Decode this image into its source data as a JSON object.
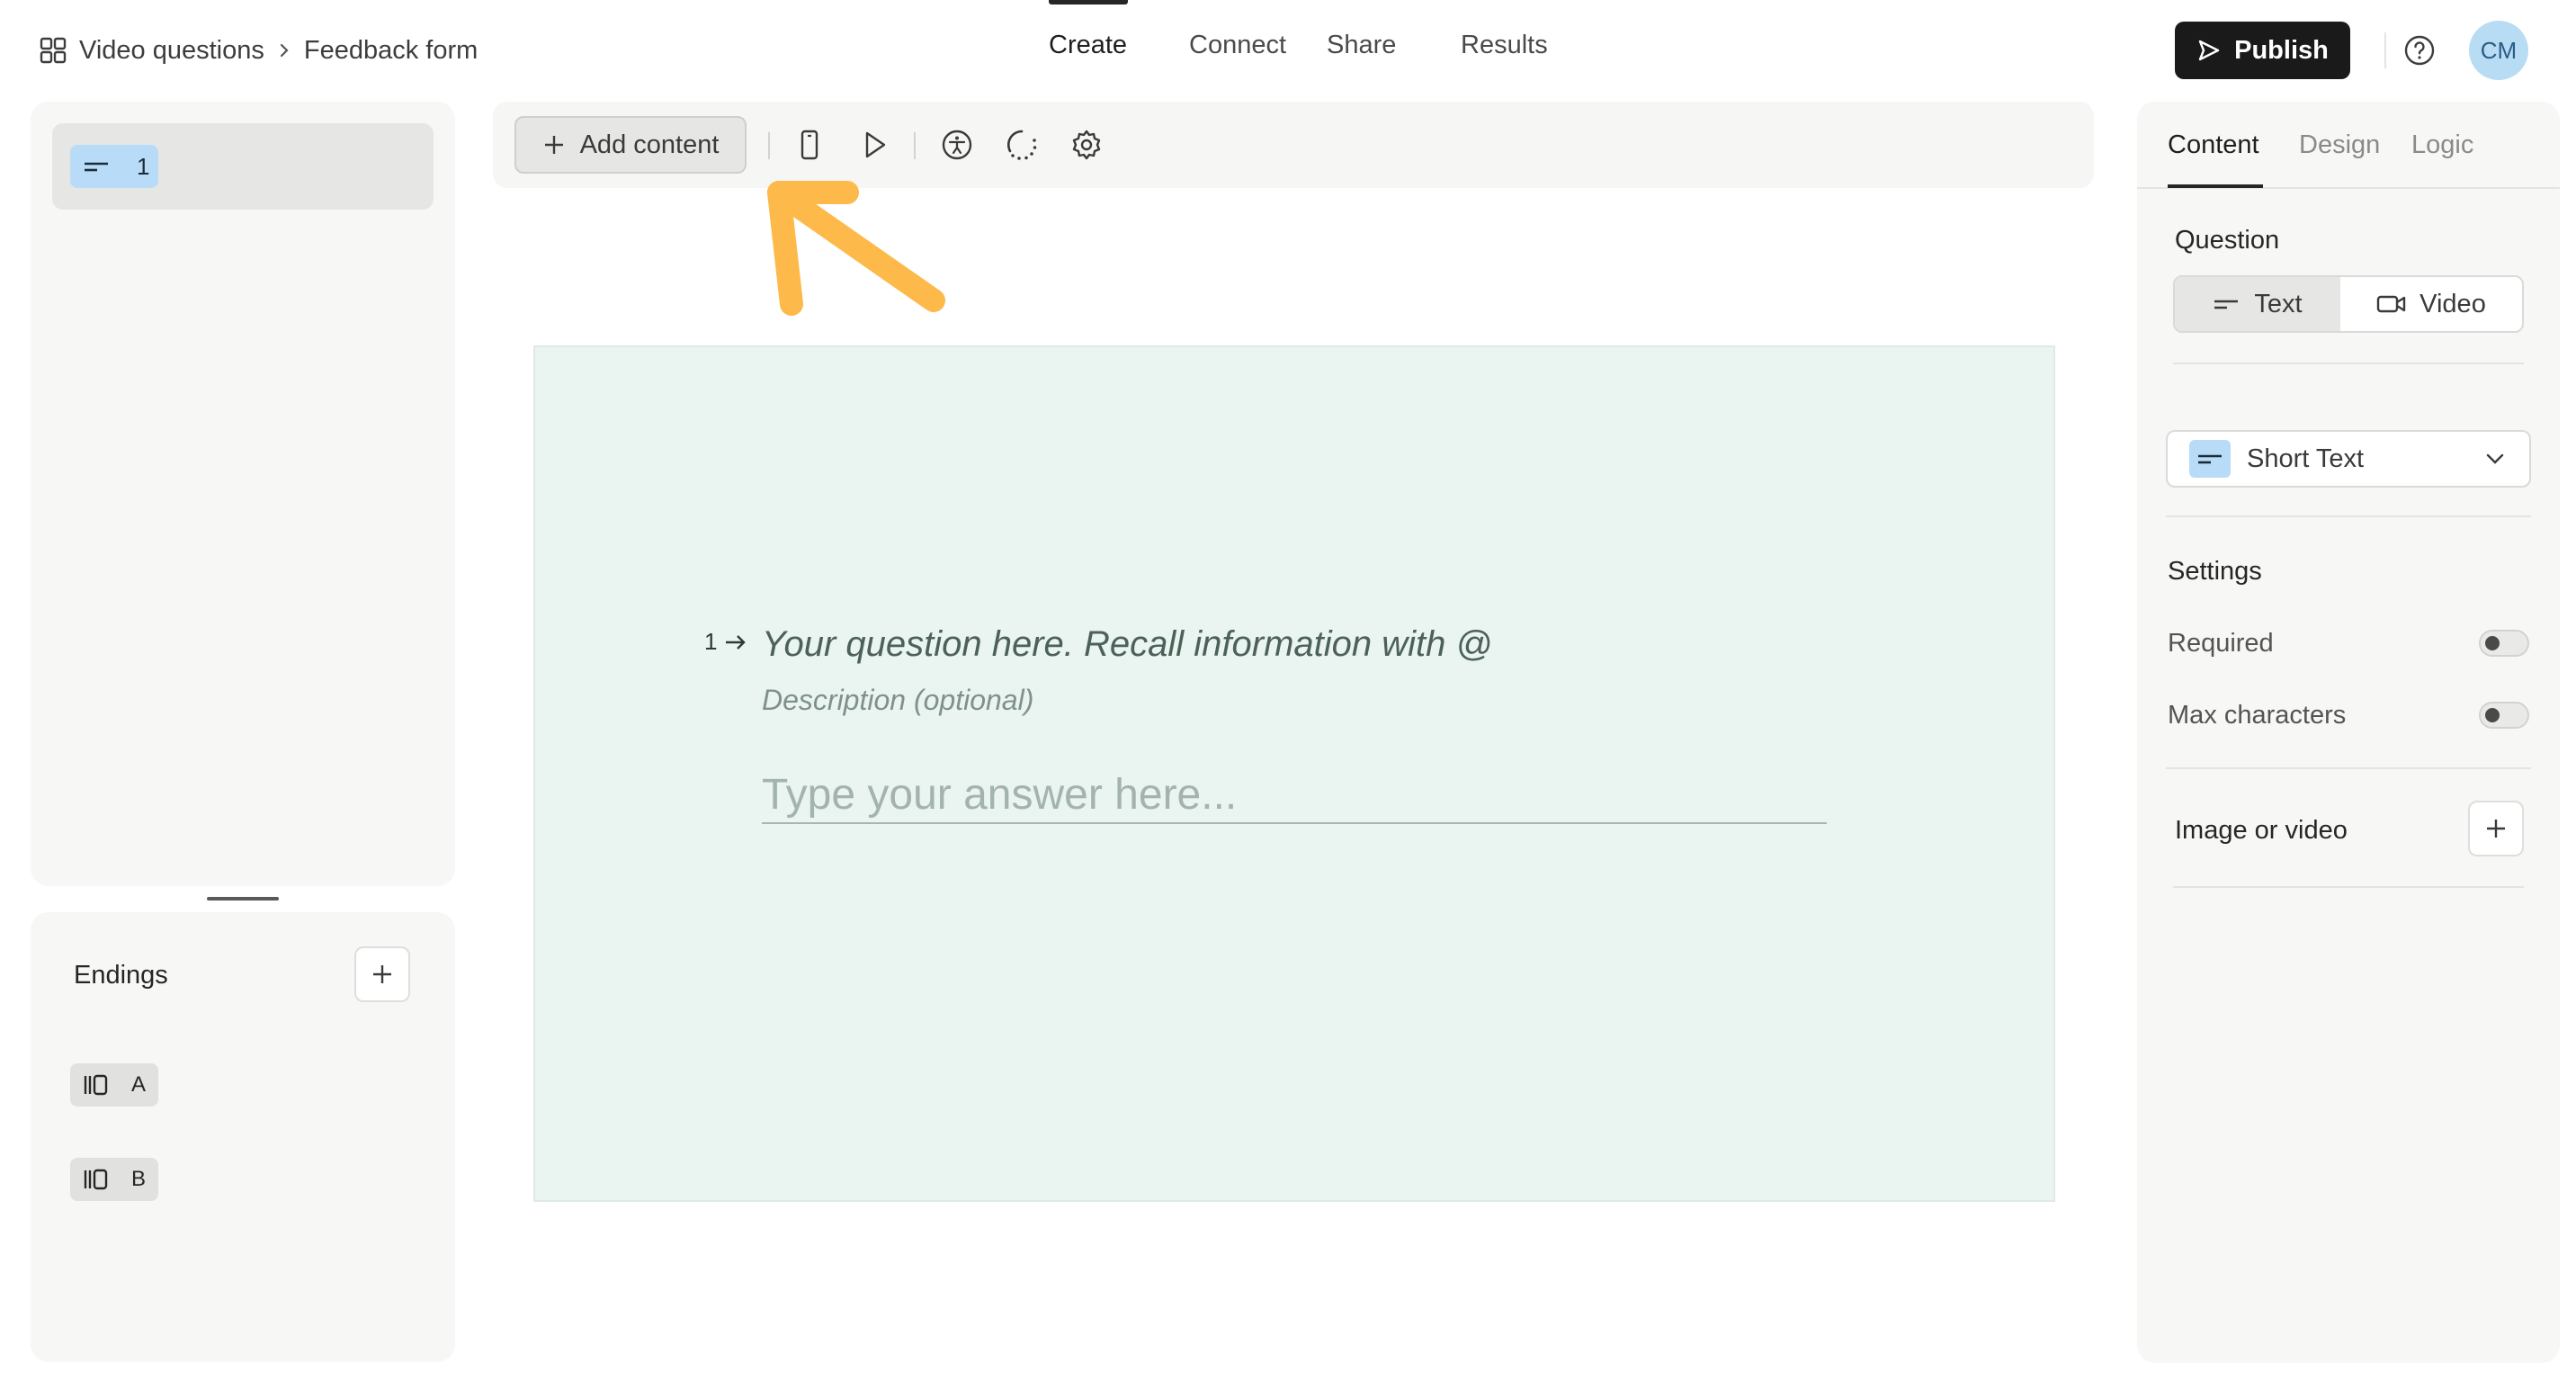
{
  "breadcrumb": {
    "workspace": "Video questions",
    "form": "Feedback form"
  },
  "nav": {
    "tabs": [
      "Create",
      "Connect",
      "Share",
      "Results"
    ],
    "active": "Create"
  },
  "header": {
    "publish_label": "Publish",
    "avatar_initials": "CM"
  },
  "left_panel": {
    "question_number": "1",
    "endings_title": "Endings",
    "endings": [
      "A",
      "B"
    ]
  },
  "toolbar": {
    "add_content_label": "Add content"
  },
  "question": {
    "number": "1",
    "title_placeholder": "Your question here. Recall information with @",
    "description_placeholder": "Description (optional)",
    "answer_placeholder": "Type your answer here..."
  },
  "right_panel": {
    "tabs": [
      "Content",
      "Design",
      "Logic"
    ],
    "active_tab": "Content",
    "question_label": "Question",
    "question_format": [
      "Text",
      "Video"
    ],
    "selected_format": "Text",
    "question_type": "Short Text",
    "settings_label": "Settings",
    "required_label": "Required",
    "required_enabled": false,
    "max_chars_label": "Max characters",
    "max_chars_enabled": false,
    "media_label": "Image or video"
  },
  "colors": {
    "accent_blue": "#b8dcf7",
    "annotation_arrow": "#fdb94a",
    "canvas_bg": "#eaf4f1",
    "publish_bg": "#1a1a1b"
  }
}
